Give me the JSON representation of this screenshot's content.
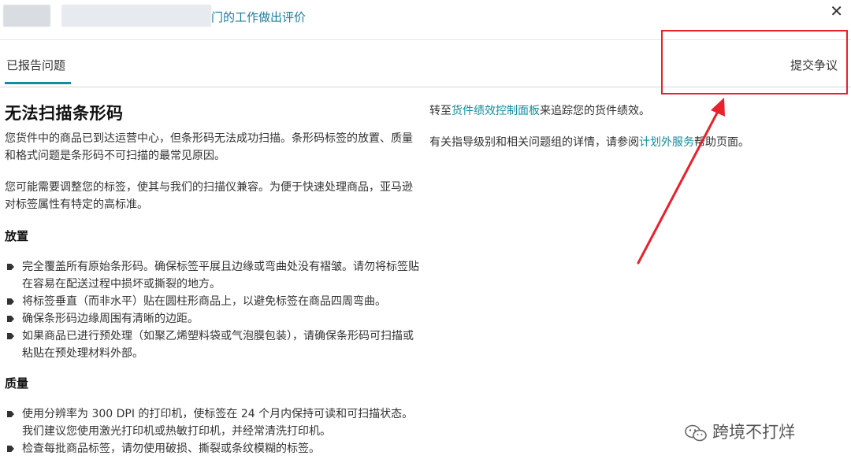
{
  "header": {
    "title_partial": "门的工作做出评价",
    "close_glyph": "✕"
  },
  "tabs": {
    "active_label": "已报告问题",
    "dispute_label": "提交争议"
  },
  "left": {
    "title": "无法扫描条形码",
    "para1": "您货件中的商品已到达运营中心，但条形码无法成功扫描。条形码标签的放置、质量和格式问题是条形码不可扫描的最常见原因。",
    "para2": "您可能需要调整您的标签，使其与我们的扫描仪兼容。为便于快速处理商品，亚马逊对标签属性有特定的高标准。",
    "section_placement": "放置",
    "placement_items": [
      "完全覆盖所有原始条形码。确保标签平展且边缘或弯曲处没有褶皱。请勿将标签贴在容易在配送过程中损坏或撕裂的地方。",
      "将标签垂直（而非水平）贴在圆柱形商品上，以避免标签在商品四周弯曲。",
      "确保条形码边缘周围有清晰的边距。",
      "如果商品已进行预处理（如聚乙烯塑料袋或气泡膜包装），请确保条形码可扫描或粘贴在预处理材料外部。"
    ],
    "section_quality": "质量",
    "quality_items": [
      "使用分辨率为 300 DPI 的打印机，使标签在 24 个月内保持可读和可扫描状态。我们建议您使用激光打印机或热敏打印机，并经常清洗打印机。",
      "检查每批商品标签，请勿使用破损、撕裂或条纹模糊的标签。"
    ]
  },
  "right": {
    "p1_prefix": "转至",
    "p1_link": "货件绩效控制面板",
    "p1_suffix": "来追踪您的货件绩效。",
    "p2_prefix": "有关指导级别和相关问题组的详情，请参阅",
    "p2_link": "计划外服务",
    "p2_suffix": "帮助页面。"
  },
  "watermark": {
    "text": "跨境不打烊",
    "icon": "wechat-icon"
  },
  "colors": {
    "accent": "#138c9e",
    "annotation": "#e8212a"
  }
}
